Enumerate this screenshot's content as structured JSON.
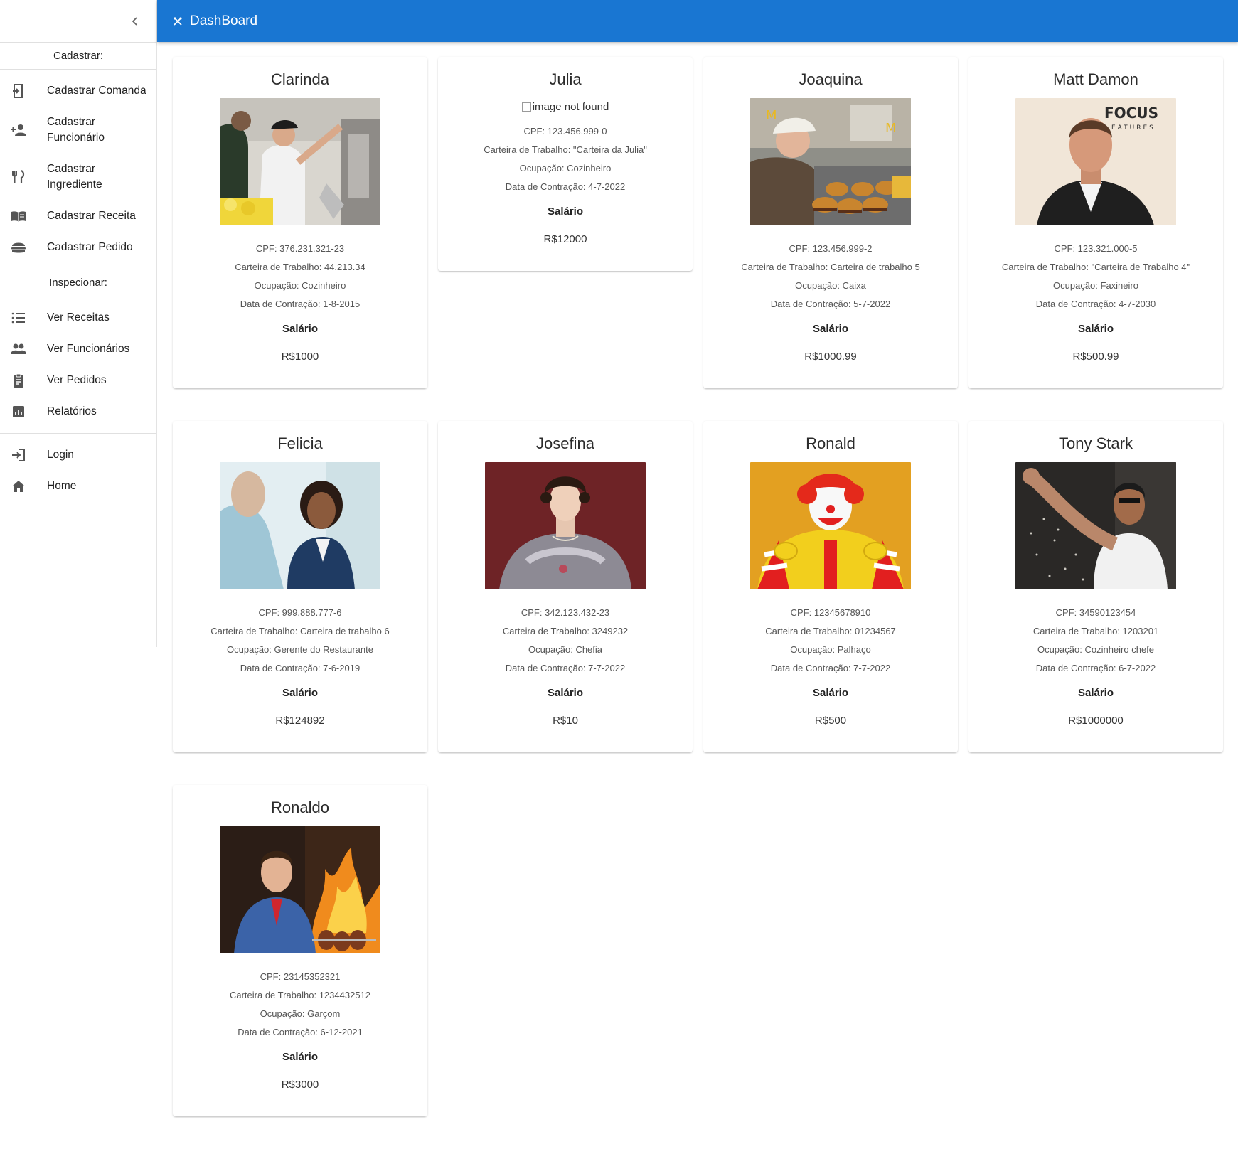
{
  "appbar": {
    "title": "DashBoard",
    "icon": "utensils-crossed-icon"
  },
  "sidebar": {
    "collapse_icon": "chevron-left-icon",
    "section_register": "Cadastrar:",
    "register_items": [
      {
        "label": "Cadastrar Comanda",
        "icon": "order-ticket-icon"
      },
      {
        "label": "Cadastrar Funcionário",
        "icon": "person-add-icon"
      },
      {
        "label": "Cadastrar Ingrediente",
        "icon": "fork-knife-icon"
      },
      {
        "label": "Cadastrar Receita",
        "icon": "menu-book-icon"
      },
      {
        "label": "Cadastrar Pedido",
        "icon": "burger-icon"
      }
    ],
    "section_inspect": "Inspecionar:",
    "inspect_items": [
      {
        "label": "Ver Receitas",
        "icon": "list-icon"
      },
      {
        "label": "Ver Funcionários",
        "icon": "people-icon"
      },
      {
        "label": "Ver Pedidos",
        "icon": "clipboard-icon"
      },
      {
        "label": "Relatórios",
        "icon": "bar-chart-icon"
      }
    ],
    "bottom_items": [
      {
        "label": "Login",
        "icon": "login-icon"
      },
      {
        "label": "Home",
        "icon": "home-icon"
      }
    ]
  },
  "salary_label": "Salário",
  "employees": [
    {
      "name": "Clarinda",
      "cpf": "CPF: 376.231.321-23",
      "carteira": "Carteira de Trabalho: 44.213.34",
      "ocupacao": "Ocupação: Cozinheiro",
      "data": "Data de Contração: 1-8-2015",
      "salario": "R$1000",
      "photo": "cashier-photo"
    },
    {
      "name": "Julia",
      "cpf": "CPF: 123.456.999-0",
      "carteira": "Carteira de Trabalho: \"Carteira da Julia\"",
      "ocupacao": "Ocupação: Cozinheiro",
      "data": "Data de Contração: 4-7-2022",
      "salario": "R$12000",
      "photo_alt": "image not found"
    },
    {
      "name": "Joaquina",
      "cpf": "CPF: 123.456.999-2",
      "carteira": "Carteira de Trabalho: Carteira de trabalho 5",
      "ocupacao": "Ocupação: Caixa",
      "data": "Data de Contração: 5-7-2022",
      "salario": "R$1000.99",
      "photo": "burgers-photo"
    },
    {
      "name": "Matt Damon",
      "cpf": "CPF: 123.321.000-5",
      "carteira": "Carteira de Trabalho: \"Carteira de Trabalho 4\"",
      "ocupacao": "Ocupação: Faxineiro",
      "data": "Data de Contração: 4-7-2030",
      "salario": "R$500.99",
      "photo": "portrait-photo",
      "photo_text_1": "FOCUS",
      "photo_text_2": "EATURES"
    },
    {
      "name": "Felicia",
      "cpf": "CPF: 999.888.777-6",
      "carteira": "Carteira de Trabalho: Carteira de trabalho 6",
      "ocupacao": "Ocupação: Gerente do Restaurante",
      "data": "Data de Contração: 7-6-2019",
      "salario": "R$124892",
      "photo": "office-photo"
    },
    {
      "name": "Josefina",
      "cpf": "CPF: 342.123.432-23",
      "carteira": "Carteira de Trabalho: 3249232",
      "ocupacao": "Ocupação: Chefia",
      "data": "Data de Contração: 7-7-2022",
      "salario": "R$10",
      "photo": "painting-photo"
    },
    {
      "name": "Ronald",
      "cpf": "CPF: 12345678910",
      "carteira": "Carteira de Trabalho: 01234567",
      "ocupacao": "Ocupação: Palhaço",
      "data": "Data de Contração: 7-7-2022",
      "salario": "R$500",
      "photo": "clown-photo"
    },
    {
      "name": "Tony Stark",
      "cpf": "CPF: 34590123454",
      "carteira": "Carteira de Trabalho: 1203201",
      "ocupacao": "Ocupação: Cozinheiro chefe",
      "data": "Data de Contração: 6-7-2022",
      "salario": "R$1000000",
      "photo": "salt-chef-photo"
    },
    {
      "name": "Ronaldo",
      "cpf": "CPF: 23145352321",
      "carteira": "Carteira de Trabalho: 1234432512",
      "ocupacao": "Ocupação: Garçom",
      "data": "Data de Contração: 6-12-2021",
      "salario": "R$3000",
      "photo": "grill-photo"
    }
  ]
}
